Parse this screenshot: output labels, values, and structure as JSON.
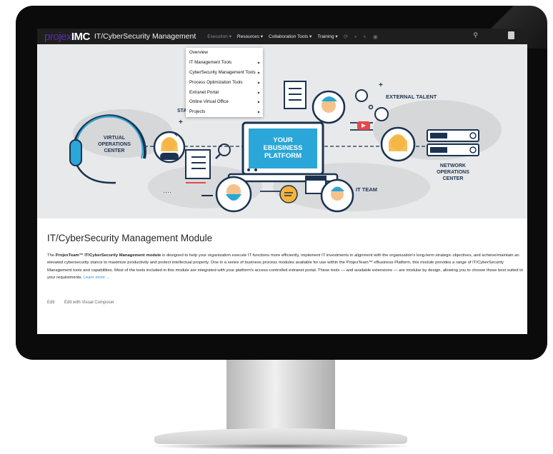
{
  "navbar": {
    "logo_part1": "pro",
    "logo_part2": "jex",
    "logo_part3": "IMC",
    "site_title": "IT/CyberSecurity Management",
    "menu": [
      {
        "label": "Execution ▾"
      },
      {
        "label": "Resources ▾"
      },
      {
        "label": "Collaboration Tools ▾"
      },
      {
        "label": "Training ▾"
      }
    ],
    "icons": [
      "refresh-icon",
      "comment-icon",
      "plus-icon",
      "dashboard-icon"
    ],
    "right_icons": [
      "search-icon",
      "user-icon"
    ]
  },
  "dropdown": {
    "items": [
      {
        "label": "Overview",
        "arrow": ""
      },
      {
        "label": "IT Management Tools",
        "arrow": "▶"
      },
      {
        "label": "CyberSecurity Management Tools",
        "arrow": "▶"
      },
      {
        "label": "Process Optimization Tools",
        "arrow": "▶"
      },
      {
        "label": "Extranet Portal",
        "arrow": "▶"
      },
      {
        "label": "Online Virtual Office",
        "arrow": "▶"
      },
      {
        "label": "Projects",
        "arrow": "▶"
      }
    ]
  },
  "hero": {
    "virtual_ops": [
      "VIRTUAL",
      "OPERATIONS",
      "CENTER"
    ],
    "platform": [
      "YOUR",
      "EBUSINESS",
      "PLATFORM"
    ],
    "external_talent": "EXTERNAL TALENT",
    "network_ops": [
      "NETWORK",
      "OPERATIONS",
      "CENTER"
    ],
    "it_team": "IT TEAM",
    "partial_label": "STA",
    "dots": "····"
  },
  "content": {
    "title": "IT/CyberSecurity Management Module",
    "desc_prefix": "The ",
    "desc_bold": "ProjexTeam™ IT/CyberSecurity Management module",
    "desc_body": " is designed to help your organization execute IT functions more efficiently, implement IT investments in alignment with the organization's long-term strategic objectives, and achieve/maintain an elevated cybersecurity stance to maximize productivity and protect intellectual property. One in a series of business process modules available for use within the ProjexTeam™ eBusiness Platform, this module provides a range of IT/CyberSecurity Management tools and capabilities. Most of the tools included in this module are integrated with your platform's access-controlled extranet portal. These tools — and available extensions — are modular by design, allowing you to choose those best suited to your requirements. ",
    "learn_more": "Learn more ...",
    "edit_label": "Edit",
    "edit_vc_label": "Edit with Visual Composer"
  },
  "colors": {
    "navbar_bg": "#1e1e1e",
    "logo_purple": "#5a2ea6",
    "platform_blue": "#2aa6d8",
    "hero_bg": "#e8e9ea",
    "link_blue": "#2a8fd0",
    "illustration_navy": "#1b3350",
    "accent_red": "#e5484d",
    "accent_yellow": "#f6b43a"
  }
}
